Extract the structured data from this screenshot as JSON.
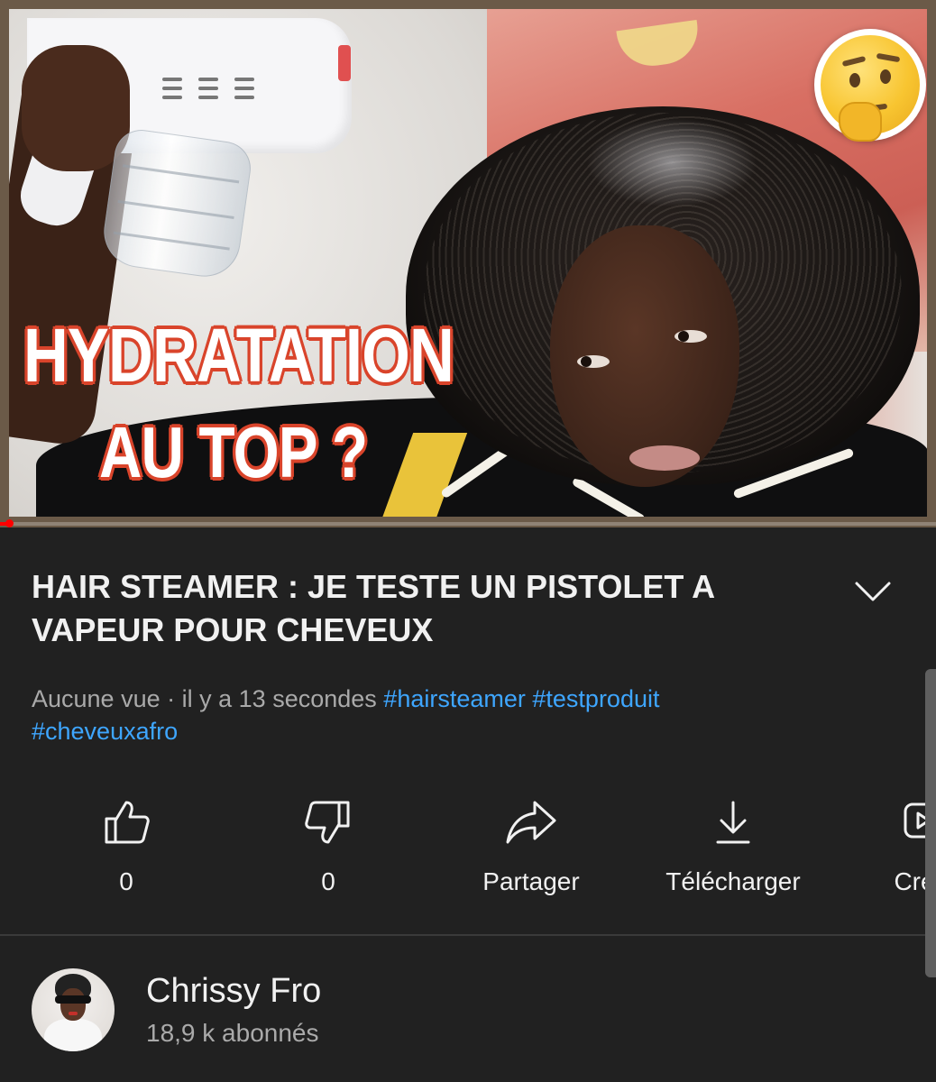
{
  "video": {
    "thumbnail_text_line1": "HYDRATATION",
    "thumbnail_text_line2": "AU TOP ?",
    "emoji": "thinking-face-emoji",
    "progress_fraction": 0.01,
    "colors": {
      "progress": "#ff0000",
      "overlay_outline": "#d9442b"
    }
  },
  "details": {
    "title": "HAIR STEAMER : JE TESTE UN PISTOLET A VAPEUR POUR CHEVEUX",
    "views": "Aucune vue",
    "separator": "·",
    "age": "il y a 13 secondes",
    "hashtags": [
      "#hairsteamer",
      "#testproduit",
      "#cheveuxafro"
    ],
    "hashtag_color": "#3ea6ff"
  },
  "actions": [
    {
      "icon": "thumbs-up-icon",
      "label": "0"
    },
    {
      "icon": "thumbs-down-icon",
      "label": "0"
    },
    {
      "icon": "share-icon",
      "label": "Partager"
    },
    {
      "icon": "download-icon",
      "label": "Télécharger"
    },
    {
      "icon": "create-icon",
      "label": "Cre"
    }
  ],
  "channel": {
    "name": "Chrissy Fro",
    "subscribers": "18,9 k abonnés"
  }
}
